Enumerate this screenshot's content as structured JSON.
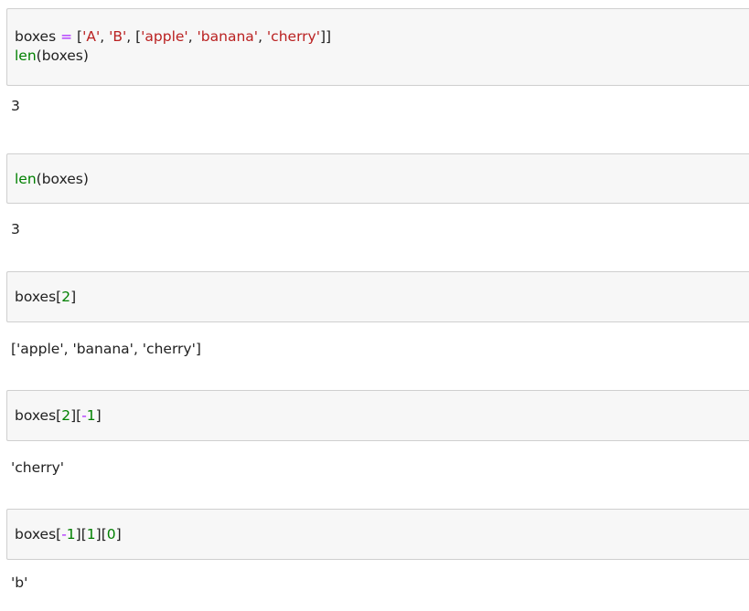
{
  "cells": [
    {
      "input_lines": [
        [
          {
            "t": "boxes ",
            "k": "name"
          },
          {
            "t": "=",
            "k": "op"
          },
          {
            "t": " [",
            "k": "name"
          },
          {
            "t": "'A'",
            "k": "str"
          },
          {
            "t": ", ",
            "k": "name"
          },
          {
            "t": "'B'",
            "k": "str"
          },
          {
            "t": ", [",
            "k": "name"
          },
          {
            "t": "'apple'",
            "k": "str"
          },
          {
            "t": ", ",
            "k": "name"
          },
          {
            "t": "'banana'",
            "k": "str"
          },
          {
            "t": ", ",
            "k": "name"
          },
          {
            "t": "'cherry'",
            "k": "str"
          },
          {
            "t": "]]",
            "k": "name"
          }
        ],
        [
          {
            "t": "len",
            "k": "builtin"
          },
          {
            "t": "(boxes)",
            "k": "name"
          }
        ]
      ],
      "output": "3"
    },
    {
      "input_lines": [
        [
          {
            "t": "len",
            "k": "builtin"
          },
          {
            "t": "(boxes)",
            "k": "name"
          }
        ]
      ],
      "output": "3"
    },
    {
      "input_lines": [
        [
          {
            "t": "boxes[",
            "k": "name"
          },
          {
            "t": "2",
            "k": "num"
          },
          {
            "t": "]",
            "k": "name"
          }
        ]
      ],
      "output": "['apple', 'banana', 'cherry']"
    },
    {
      "input_lines": [
        [
          {
            "t": "boxes[",
            "k": "name"
          },
          {
            "t": "2",
            "k": "num"
          },
          {
            "t": "][",
            "k": "name"
          },
          {
            "t": "-",
            "k": "op"
          },
          {
            "t": "1",
            "k": "num"
          },
          {
            "t": "]",
            "k": "name"
          }
        ]
      ],
      "output": "'cherry'"
    },
    {
      "input_lines": [
        [
          {
            "t": "boxes[",
            "k": "name"
          },
          {
            "t": "-",
            "k": "op"
          },
          {
            "t": "1",
            "k": "num"
          },
          {
            "t": "][",
            "k": "name"
          },
          {
            "t": "1",
            "k": "num"
          },
          {
            "t": "][",
            "k": "name"
          },
          {
            "t": "0",
            "k": "num"
          },
          {
            "t": "]",
            "k": "name"
          }
        ]
      ],
      "output": "'b'"
    }
  ],
  "colors": {
    "input_background": "#f7f7f7",
    "input_border": "#cfcfcf",
    "operator": "#aa22ff",
    "string": "#ba2121",
    "number": "#008000",
    "builtin": "#008000",
    "text": "#212121"
  }
}
